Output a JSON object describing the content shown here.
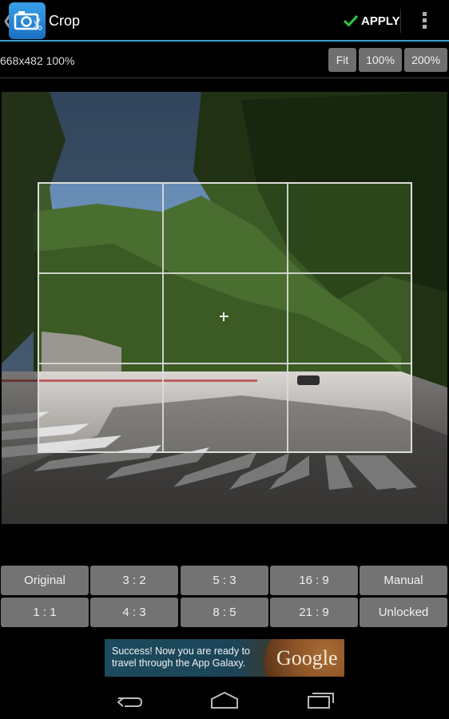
{
  "actionbar": {
    "title": "Crop",
    "apply_label": "APPLY",
    "apply_icon": "checkmark-icon",
    "overflow_icon": "overflow-menu-icon",
    "app_icon": "camera-icon",
    "back_icon": "back-chevron-icon",
    "accent_color": "#3a9fd0",
    "apply_icon_color": "#2ecc40"
  },
  "infobar": {
    "dimensions_text": "668x482 100%",
    "zoom_buttons": [
      "Fit",
      "100%",
      "200%"
    ]
  },
  "crop": {
    "grid": "rule-of-thirds",
    "center_marker": "crosshair-icon"
  },
  "ratios": {
    "row1": [
      "Original",
      "3 : 2",
      "5 : 3",
      "16 : 9",
      "Manual"
    ],
    "row2": [
      "1 : 1",
      "4 : 3",
      "8 : 5",
      "21 : 9",
      "Unlocked"
    ]
  },
  "ad": {
    "text": "Success! Now you are ready to travel through the App Galaxy.",
    "brand": "Google"
  },
  "navbar": {
    "items": [
      "back-icon",
      "home-icon",
      "recent-apps-icon"
    ]
  }
}
